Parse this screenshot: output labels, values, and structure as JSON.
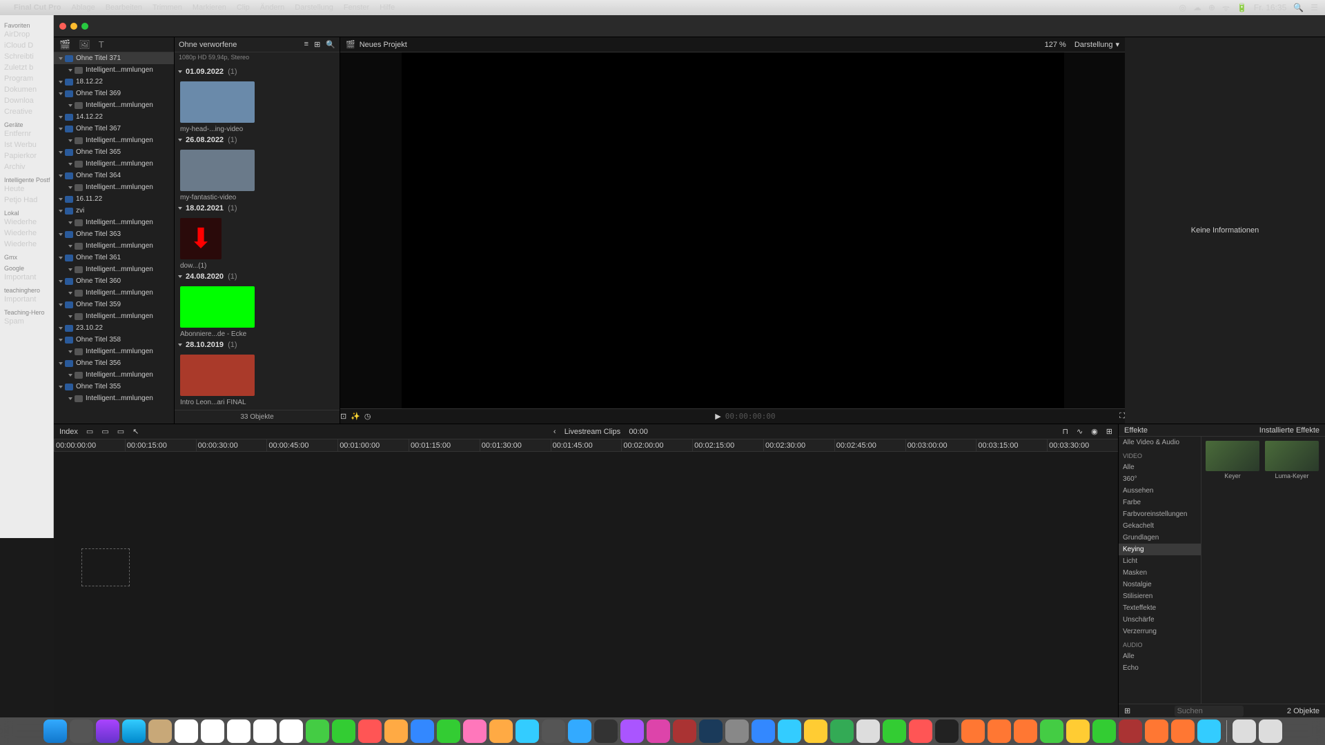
{
  "menubar": {
    "app_name": "Final Cut Pro",
    "items": [
      "Ablage",
      "Bearbeiten",
      "Trimmen",
      "Markieren",
      "Clip",
      "Ändern",
      "Darstellung",
      "Fenster",
      "Hilfe"
    ],
    "right": {
      "time": "Fr. 16:35"
    }
  },
  "finder": {
    "sections": [
      {
        "title": "Favoriten",
        "items": [
          "AirDrop",
          "iCloud D",
          "Schreibti",
          "Zuletzt b",
          "Program",
          "Dokumen",
          "Downloa",
          "Creative"
        ]
      },
      {
        "title": "Geräte",
        "items": [
          "Entfernr"
        ]
      },
      {
        "title": "",
        "items": [
          "Ist Werbu",
          "Papierkor",
          "Archiv"
        ]
      },
      {
        "title": "Intelligente Postf",
        "items": [
          "Heute",
          "Petjo Had"
        ]
      },
      {
        "title": "Lokal",
        "items": [
          "Wiederhe",
          "Wiederhe",
          "Wiederhe"
        ]
      },
      {
        "title": "Gmx",
        "items": []
      },
      {
        "title": "Google",
        "items": [
          "Important"
        ]
      },
      {
        "title": "teachinghero",
        "items": [
          "Important"
        ]
      },
      {
        "title": "Teaching-Hero",
        "items": [
          "Spam"
        ]
      }
    ]
  },
  "library_tree": [
    {
      "label": "Ohne Titel 371",
      "selected": true
    },
    {
      "label": "Intelligent...mmlungen",
      "indent": true
    },
    {
      "label": "18.12.22"
    },
    {
      "label": "Ohne Titel 369"
    },
    {
      "label": "Intelligent...mmlungen",
      "indent": true
    },
    {
      "label": "14.12.22"
    },
    {
      "label": "Ohne Titel 367"
    },
    {
      "label": "Intelligent...mmlungen",
      "indent": true
    },
    {
      "label": "Ohne Titel 365"
    },
    {
      "label": "Intelligent...mmlungen",
      "indent": true
    },
    {
      "label": "Ohne Titel 364"
    },
    {
      "label": "Intelligent...mmlungen",
      "indent": true
    },
    {
      "label": "16.11.22"
    },
    {
      "label": "zvi"
    },
    {
      "label": "Intelligent...mmlungen",
      "indent": true
    },
    {
      "label": "Ohne Titel 363"
    },
    {
      "label": "Intelligent...mmlungen",
      "indent": true
    },
    {
      "label": "Ohne Titel 361"
    },
    {
      "label": "Intelligent...mmlungen",
      "indent": true
    },
    {
      "label": "Ohne Titel 360"
    },
    {
      "label": "Intelligent...mmlungen",
      "indent": true
    },
    {
      "label": "Ohne Titel 359"
    },
    {
      "label": "Intelligent...mmlungen",
      "indent": true
    },
    {
      "label": "23.10.22"
    },
    {
      "label": "Ohne Titel 358"
    },
    {
      "label": "Intelligent...mmlungen",
      "indent": true
    },
    {
      "label": "Ohne Titel 356"
    },
    {
      "label": "Intelligent...mmlungen",
      "indent": true
    },
    {
      "label": "Ohne Titel 355"
    },
    {
      "label": "Intelligent...mmlungen",
      "indent": true
    }
  ],
  "browser": {
    "filter": "Ohne verworfene",
    "media_info": "1080p HD 59,94p, Stereo",
    "groups": [
      {
        "date": "01.09.2022",
        "count": "(1)",
        "thumbs": [
          {
            "label": "my-head-...ing-video",
            "bg": "#6a8aaa"
          }
        ]
      },
      {
        "date": "26.08.2022",
        "count": "(1)",
        "thumbs": [
          {
            "label": "my-fantastic-video",
            "bg": "#6a7a8a"
          }
        ]
      },
      {
        "date": "18.02.2021",
        "count": "(1)",
        "thumbs": [
          {
            "label": "dow...(1)",
            "bg": "#2a0a0a",
            "icon": "red-arrow"
          }
        ]
      },
      {
        "date": "24.08.2020",
        "count": "(1)",
        "thumbs": [
          {
            "label": "Abonniere...de - Ecke",
            "bg": "#00ff00"
          }
        ]
      },
      {
        "date": "28.10.2019",
        "count": "(1)",
        "thumbs": [
          {
            "label": "Intro Leon...ari FINAL",
            "bg": "#aa3a2a"
          }
        ]
      }
    ],
    "footer": "33 Objekte"
  },
  "viewer": {
    "project_label": "Neues Projekt",
    "zoom": "127 %",
    "darstellung": "Darstellung",
    "timecode": "00:00:00:00"
  },
  "inspector": {
    "empty": "Keine Informationen"
  },
  "timeline": {
    "index_label": "Index",
    "title": "Livestream Clips",
    "time": "00:00",
    "ruler": [
      "00:00:00:00",
      "00:00:15:00",
      "00:00:30:00",
      "00:00:45:00",
      "00:01:00:00",
      "00:01:15:00",
      "00:01:30:00",
      "00:01:45:00",
      "00:02:00:00",
      "00:02:15:00",
      "00:02:30:00",
      "00:02:45:00",
      "00:03:00:00",
      "00:03:15:00",
      "00:03:30:00"
    ]
  },
  "effects": {
    "title": "Effekte",
    "installed": "Installierte Effekte",
    "categories": [
      {
        "label": "Alle Video & Audio"
      },
      {
        "label": "VIDEO",
        "section": true
      },
      {
        "label": "Alle"
      },
      {
        "label": "360°"
      },
      {
        "label": "Aussehen"
      },
      {
        "label": "Farbe"
      },
      {
        "label": "Farbvoreinstellungen"
      },
      {
        "label": "Gekachelt"
      },
      {
        "label": "Grundlagen"
      },
      {
        "label": "Keying",
        "selected": true
      },
      {
        "label": "Licht"
      },
      {
        "label": "Masken"
      },
      {
        "label": "Nostalgie"
      },
      {
        "label": "Stilisieren"
      },
      {
        "label": "Texteffekte"
      },
      {
        "label": "Unschärfe"
      },
      {
        "label": "Verzerrung"
      },
      {
        "label": "AUDIO",
        "section": true
      },
      {
        "label": "Alle"
      },
      {
        "label": "Echo"
      }
    ],
    "items": [
      {
        "label": "Keyer"
      },
      {
        "label": "Luma-Keyer"
      }
    ],
    "search_placeholder": "Suchen",
    "footer": "2 Objekte"
  }
}
